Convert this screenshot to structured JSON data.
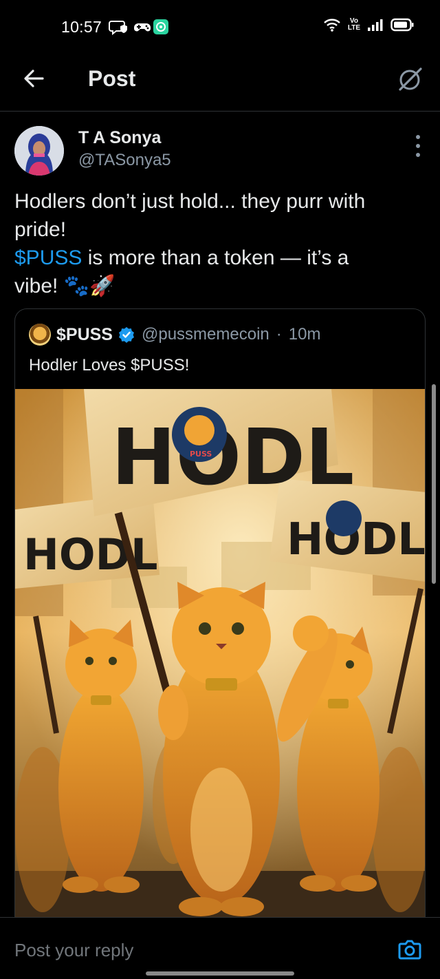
{
  "status_bar": {
    "time": "10:57",
    "volte": [
      "Vo",
      "LTE"
    ],
    "icons": [
      "shield-chat-icon",
      "gamepad-icon",
      "app-badge-icon",
      "wifi-icon",
      "signal-icon",
      "battery-icon"
    ]
  },
  "header": {
    "title": "Post",
    "back_icon": "arrow-left-icon",
    "grok_icon": "grok-icon"
  },
  "post": {
    "author_name": "T A Sonya",
    "author_handle": "@TASonya5",
    "text_line1": "Hodlers don’t just hold... they purr with",
    "text_line2": "pride!",
    "text_line3_cashtag": "$PUSS",
    "text_line3_rest": " is more than a token — it’s a",
    "text_line4": "vibe! 🐾🚀"
  },
  "quote": {
    "name": "$PUSS",
    "handle": "@pussmemecoin",
    "separator": "·",
    "time": "10m",
    "text": "Hodler Loves $PUSS!",
    "image_sign_text": "HODL",
    "image_badge_text": "PUSS"
  },
  "reply": {
    "placeholder": "Post your reply"
  },
  "colors": {
    "background": "#000000",
    "text": "#e7e9ea",
    "secondary_text": "#8b98a5",
    "accent": "#1d9bf0",
    "border": "#2f3336"
  }
}
